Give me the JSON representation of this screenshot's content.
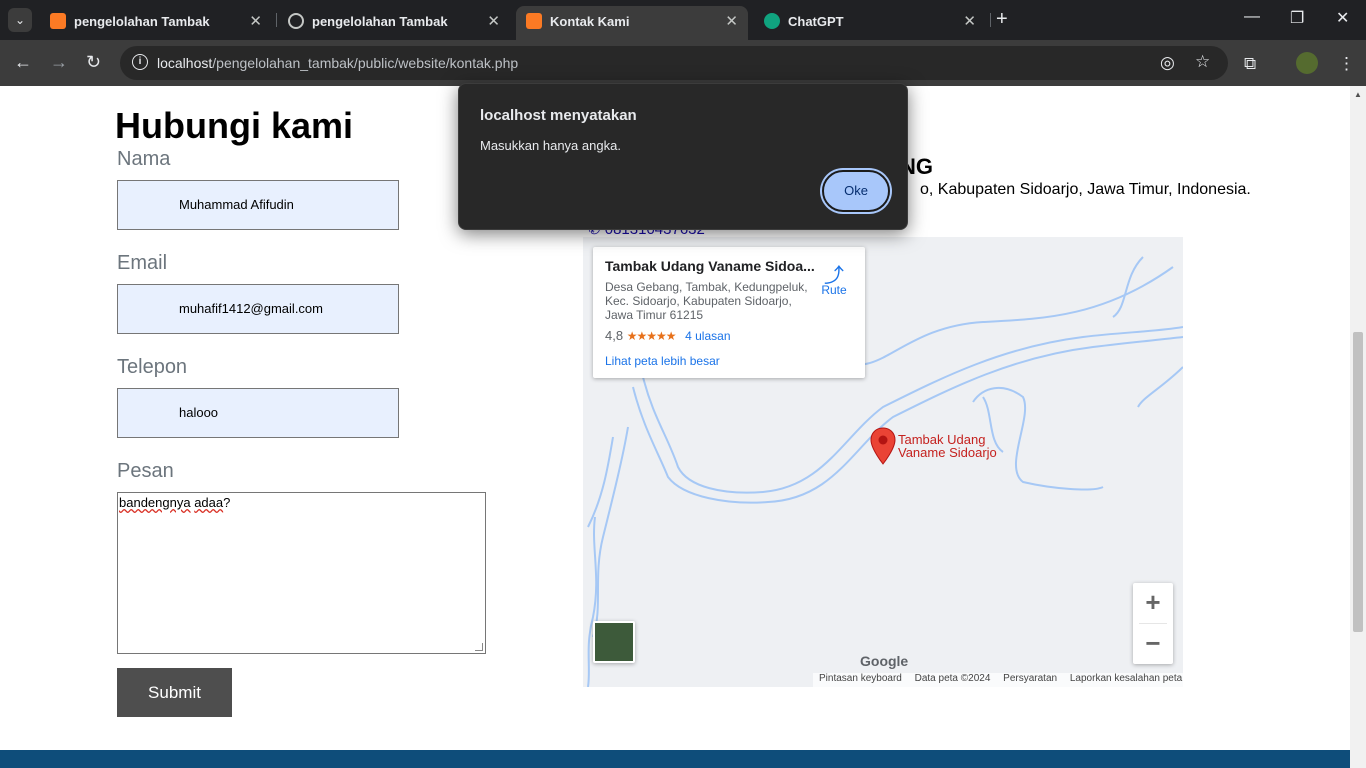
{
  "browser": {
    "tabs": [
      {
        "title": "pengelolahan Tambak",
        "favicon": "xampp-icon"
      },
      {
        "title": "pengelolahan Tambak",
        "favicon": "globe-icon"
      },
      {
        "title": "Kontak Kami",
        "favicon": "xampp-icon",
        "active": true
      },
      {
        "title": "ChatGPT",
        "favicon": "chatgpt-icon"
      }
    ],
    "url_host": "localhost",
    "url_path": "/pengelolahan_tambak/public/website/kontak.php"
  },
  "page": {
    "title": "Hubungi kami",
    "form": {
      "name_label": "Nama",
      "name_value": "Muhammad Afifudin",
      "email_label": "Email",
      "email_value": "muhafif1412@gmail.com",
      "phone_label": "Telepon",
      "phone_value": "halooo",
      "message_label": "Pesan",
      "message_word1": "bandengnya",
      "message_word2": "adaa",
      "message_tail": "?",
      "submit_label": "Submit"
    },
    "shop_name_fragment": "NG",
    "address_fragment": "o, Kabupaten Sidoarjo, Jawa Timur, Indonesia.",
    "phone_fragment": "081310437632"
  },
  "map": {
    "place_name": "Tambak Udang Vaname Sidoa...",
    "place_address": "Desa Gebang, Tambak, Kedungpeluk, Kec. Sidoarjo, Kabupaten Sidoarjo, Jawa Timur 61215",
    "rating": "4,8",
    "stars": "★★★★★",
    "reviews": "4 ulasan",
    "directions_label": "Rute",
    "larger_map": "Lihat peta lebih besar",
    "pin_label_line1": "Tambak Udang",
    "pin_label_line2": "Vaname Sidoarjo",
    "google_logo": "Google",
    "attrib_shortcuts": "Pintasan keyboard",
    "attrib_data": "Data peta ©2024",
    "attrib_terms": "Persyaratan",
    "attrib_report": "Laporkan kesalahan peta"
  },
  "dialog": {
    "title": "localhost menyatakan",
    "message": "Masukkan hanya angka.",
    "ok_label": "Oke"
  },
  "colors": {
    "dialog_bg": "#282828",
    "ok_button": "#a8c7fa",
    "input_autofill": "#e8f0fe",
    "submit_bg": "#4e4e4e",
    "footer": "#0e4d7a",
    "river": "#a6c8f5"
  }
}
